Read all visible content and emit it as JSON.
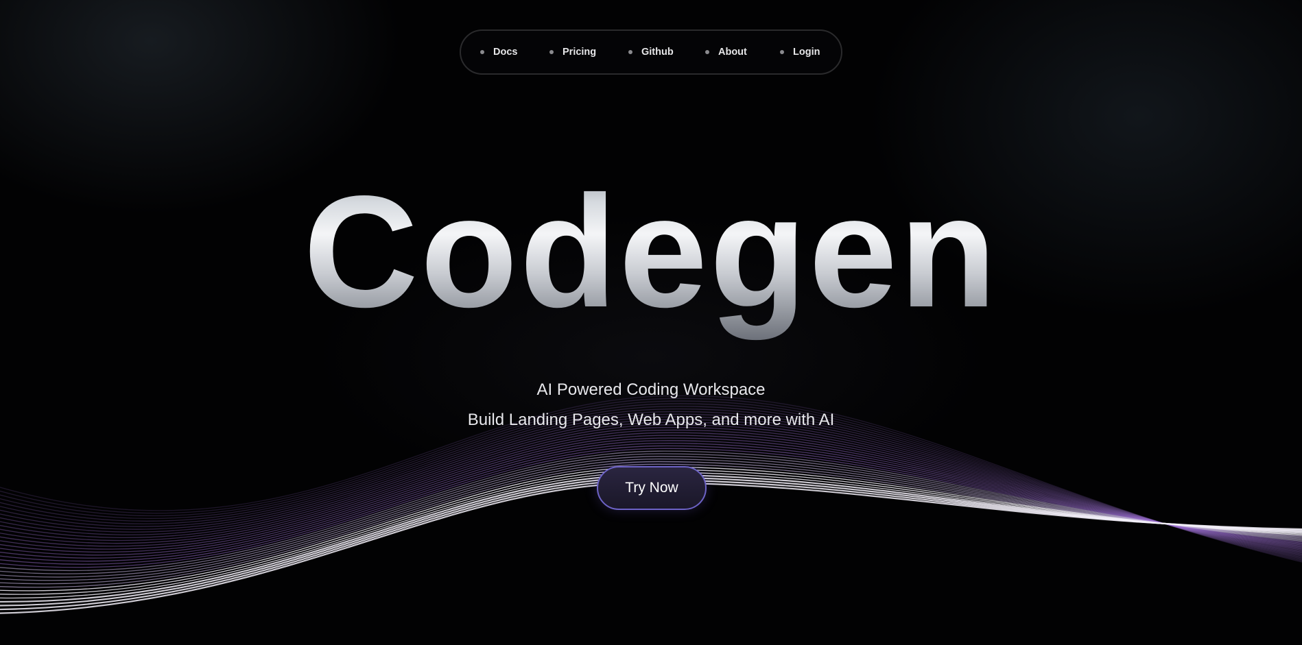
{
  "nav": {
    "items": [
      {
        "label": "Docs"
      },
      {
        "label": "Pricing"
      },
      {
        "label": "Github"
      },
      {
        "label": "About"
      },
      {
        "label": "Login"
      }
    ]
  },
  "hero": {
    "title": "Codegen",
    "subtitle_line1": "AI Powered Coding Workspace",
    "subtitle_line2": "Build Landing Pages, Web Apps, and more with AI",
    "cta_label": "Try Now"
  },
  "colors": {
    "background": "#020203",
    "wave_purple": "#9b6fd0",
    "wave_white": "#f2eef8",
    "cta_border": "#6d63c7"
  }
}
